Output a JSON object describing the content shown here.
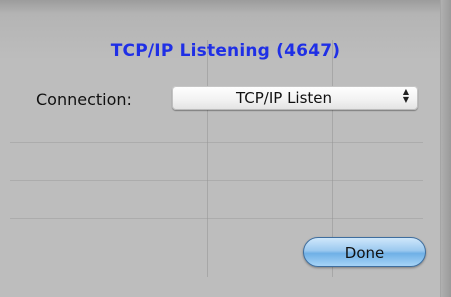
{
  "dialog": {
    "title": "TCP/IP Listening (4647)",
    "connection_label": "Connection:",
    "connection_value": "TCP/IP Listen",
    "done_label": "Done"
  },
  "colors": {
    "title": "#1f2fe6",
    "background": "#bdbdbd",
    "button_blue": "#6fb0e6"
  },
  "icons": {
    "popup_arrows": "up-down-chevrons-icon"
  }
}
